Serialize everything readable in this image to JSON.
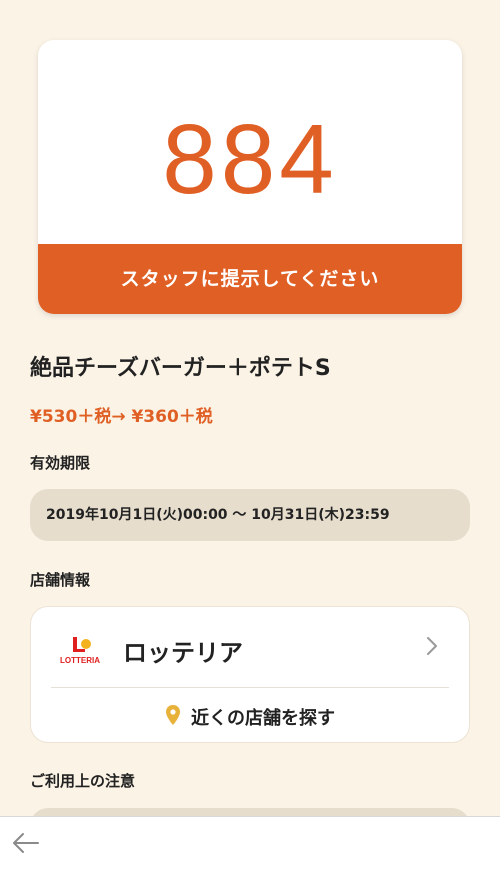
{
  "coupon": {
    "code": "884",
    "instruction": "スタッフに提示してください"
  },
  "product": {
    "title": "絶品チーズバーガー＋ポテトS",
    "price": "¥530＋税→ ¥360＋税"
  },
  "validity": {
    "heading": "有効期限",
    "period": "2019年10月1日(火)00:00 〜 10月31日(木)23:59"
  },
  "store_info": {
    "heading": "店舗情報",
    "logo_text": "LOTTERIA",
    "name": "ロッテリア",
    "find_label": "近くの店舗を探す"
  },
  "notes": {
    "heading": "ご利用上の注意"
  },
  "colors": {
    "accent": "#e05f24",
    "background": "#fbf3e6",
    "pill": "#e6ddcd",
    "pin": "#e8b23a"
  },
  "icons": {
    "back": "back-arrow-icon",
    "chevron": "chevron-right-icon",
    "pin": "location-pin-icon"
  }
}
